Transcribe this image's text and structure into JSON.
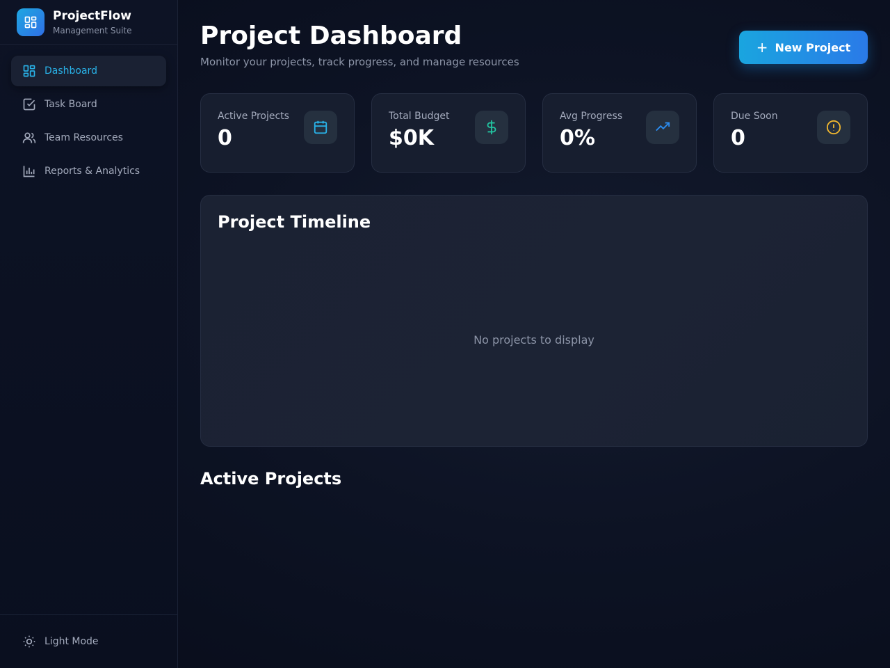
{
  "brand": {
    "name": "ProjectFlow",
    "subtitle": "Management Suite"
  },
  "sidebar": {
    "items": [
      {
        "label": "Dashboard",
        "icon": "dashboard-icon",
        "active": true
      },
      {
        "label": "Task Board",
        "icon": "checkbox-icon",
        "active": false
      },
      {
        "label": "Team Resources",
        "icon": "users-icon",
        "active": false
      },
      {
        "label": "Reports & Analytics",
        "icon": "bar-chart-icon",
        "active": false
      }
    ],
    "theme_toggle": {
      "label": "Light Mode",
      "icon": "sun-icon"
    }
  },
  "header": {
    "title": "Project Dashboard",
    "subtitle": "Monitor your projects, track progress, and manage resources",
    "new_button": {
      "icon": "plus-icon",
      "label": "New Project"
    }
  },
  "stats": [
    {
      "label": "Active Projects",
      "value": "0",
      "icon": "calendar-icon",
      "color": "#29b2e8"
    },
    {
      "label": "Total Budget",
      "value": "$0K",
      "icon": "dollar-icon",
      "color": "#22c3a0"
    },
    {
      "label": "Avg Progress",
      "value": "0%",
      "icon": "trending-up-icon",
      "color": "#2b8cf0"
    },
    {
      "label": "Due Soon",
      "value": "0",
      "icon": "alert-circle-icon",
      "color": "#f2b82e"
    }
  ],
  "timeline": {
    "title": "Project Timeline",
    "empty_text": "No projects to display"
  },
  "active_projects": {
    "title": "Active Projects"
  },
  "colors": {
    "accent": "#29b2e8",
    "button_gradient_start": "#1aa5df",
    "button_gradient_end": "#2a7ae8"
  }
}
